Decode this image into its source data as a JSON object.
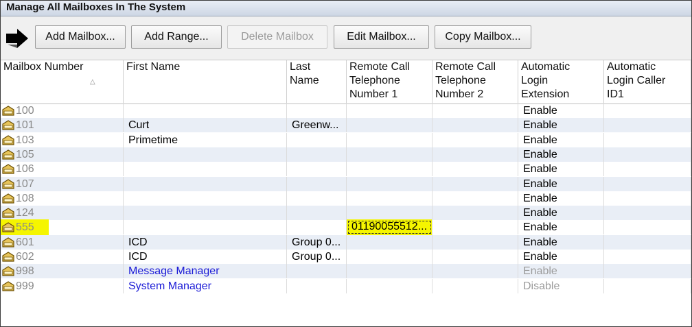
{
  "window": {
    "title": "Manage All Mailboxes In The System"
  },
  "toolbar": {
    "buttons": [
      {
        "label": "Add Mailbox...",
        "enabled": true
      },
      {
        "label": "Add Range...",
        "enabled": true
      },
      {
        "label": "Delete Mailbox",
        "enabled": false
      },
      {
        "label": "Edit Mailbox...",
        "enabled": true
      },
      {
        "label": "Copy Mailbox...",
        "enabled": true
      }
    ]
  },
  "table": {
    "columns": [
      "Mailbox Number",
      "First Name",
      "Last\nName",
      "Remote Call\nTelephone\nNumber 1",
      "Remote Call\nTelephone\nNumber 2",
      "Automatic\nLogin\nExtension",
      "Automatic\nLogin Caller\nID1"
    ],
    "sorted_column": "Mailbox Number",
    "rows": [
      {
        "mailbox": "100",
        "first": "",
        "last": "",
        "remote1": "",
        "remote2": "",
        "auto_login": "Enable",
        "caller_id": ""
      },
      {
        "mailbox": "101",
        "first": "Curt",
        "last": "Greenw...",
        "remote1": "",
        "remote2": "",
        "auto_login": "Enable",
        "caller_id": ""
      },
      {
        "mailbox": "103",
        "first": "Primetime",
        "last": "",
        "remote1": "",
        "remote2": "",
        "auto_login": "Enable",
        "caller_id": ""
      },
      {
        "mailbox": "105",
        "first": "",
        "last": "",
        "remote1": "",
        "remote2": "",
        "auto_login": "Enable",
        "caller_id": ""
      },
      {
        "mailbox": "106",
        "first": "",
        "last": "",
        "remote1": "",
        "remote2": "",
        "auto_login": "Enable",
        "caller_id": ""
      },
      {
        "mailbox": "107",
        "first": "",
        "last": "",
        "remote1": "",
        "remote2": "",
        "auto_login": "Enable",
        "caller_id": ""
      },
      {
        "mailbox": "108",
        "first": "",
        "last": "",
        "remote1": "",
        "remote2": "",
        "auto_login": "Enable",
        "caller_id": ""
      },
      {
        "mailbox": "124",
        "first": "",
        "last": "",
        "remote1": "",
        "remote2": "",
        "auto_login": "Enable",
        "caller_id": ""
      },
      {
        "mailbox": "555",
        "first": "",
        "last": "",
        "remote1": "01190055512...",
        "remote2": "",
        "auto_login": "Enable",
        "caller_id": ""
      },
      {
        "mailbox": "601",
        "first": "ICD",
        "last": "Group 0...",
        "remote1": "",
        "remote2": "",
        "auto_login": "Enable",
        "caller_id": ""
      },
      {
        "mailbox": "602",
        "first": "ICD",
        "last": "Group 0...",
        "remote1": "",
        "remote2": "",
        "auto_login": "Enable",
        "caller_id": ""
      },
      {
        "mailbox": "998",
        "first": "Message Manager",
        "last": "",
        "remote1": "",
        "remote2": "",
        "auto_login": "Enable",
        "caller_id": ""
      },
      {
        "mailbox": "999",
        "first": "System Manager",
        "last": "",
        "remote1": "",
        "remote2": "",
        "auto_login": "Disable",
        "caller_id": ""
      }
    ]
  },
  "colors": {
    "highlight": "#f5f500",
    "alt_row": "#e9eef6",
    "link": "#1a1ad6"
  },
  "icons": {
    "toolbar_arrow": "right-arrow-icon",
    "mailbox": "mailbox-icon"
  }
}
